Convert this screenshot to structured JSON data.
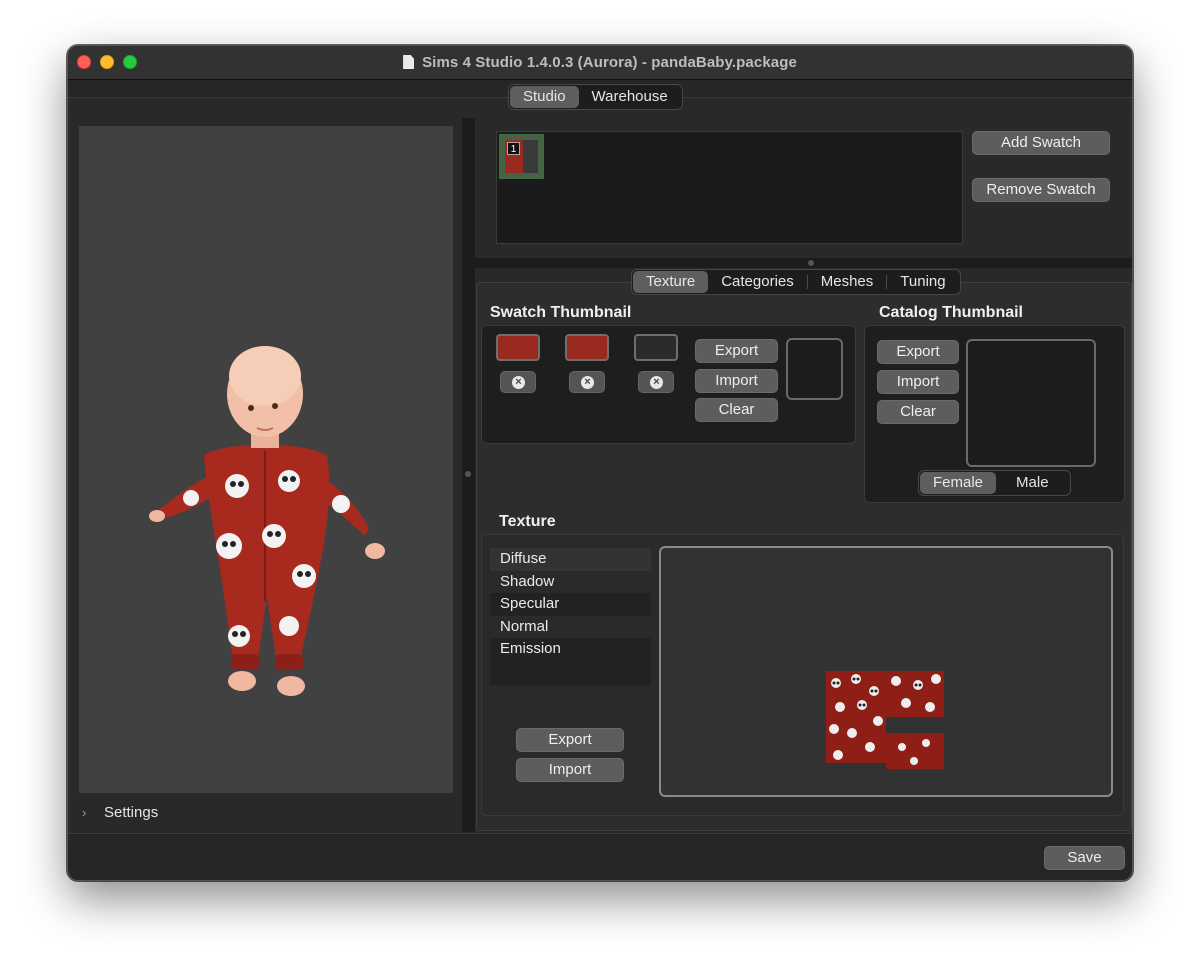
{
  "window": {
    "title": "Sims 4 Studio 1.4.0.3 (Aurora)  - pandaBaby.package"
  },
  "top_tabs": [
    {
      "label": "Studio",
      "active": true
    },
    {
      "label": "Warehouse",
      "active": false
    }
  ],
  "left_panel": {
    "settings_label": "Settings"
  },
  "swatches": {
    "items": [
      {
        "number": "1",
        "colors": [
          "#9a2a1f",
          "#3a3a3a"
        ]
      }
    ],
    "add_label": "Add Swatch",
    "remove_label": "Remove Swatch"
  },
  "sub_tabs": [
    {
      "label": "Texture",
      "active": true
    },
    {
      "label": "Categories",
      "active": false
    },
    {
      "label": "Meshes",
      "active": false
    },
    {
      "label": "Tuning",
      "active": false
    }
  ],
  "swatch_thumbnail": {
    "title": "Swatch Thumbnail",
    "colors": [
      "#9a2a1f",
      "#9a2a1f",
      "#2b2b2b"
    ],
    "clear_icon": "x-circle-icon",
    "export_label": "Export",
    "import_label": "Import",
    "clear_label": "Clear"
  },
  "catalog_thumbnail": {
    "title": "Catalog Thumbnail",
    "export_label": "Export",
    "import_label": "Import",
    "clear_label": "Clear",
    "gender_tabs": [
      {
        "label": "Female",
        "active": true
      },
      {
        "label": "Male",
        "active": false
      }
    ]
  },
  "texture": {
    "title": "Texture",
    "items": [
      "Diffuse",
      "Shadow",
      "Specular",
      "Normal",
      "Emission"
    ],
    "selected": "Diffuse",
    "export_label": "Export",
    "import_label": "Import"
  },
  "footer": {
    "save_label": "Save"
  },
  "colors": {
    "accent_red": "#9a2a1f",
    "window_bg": "#262626"
  }
}
